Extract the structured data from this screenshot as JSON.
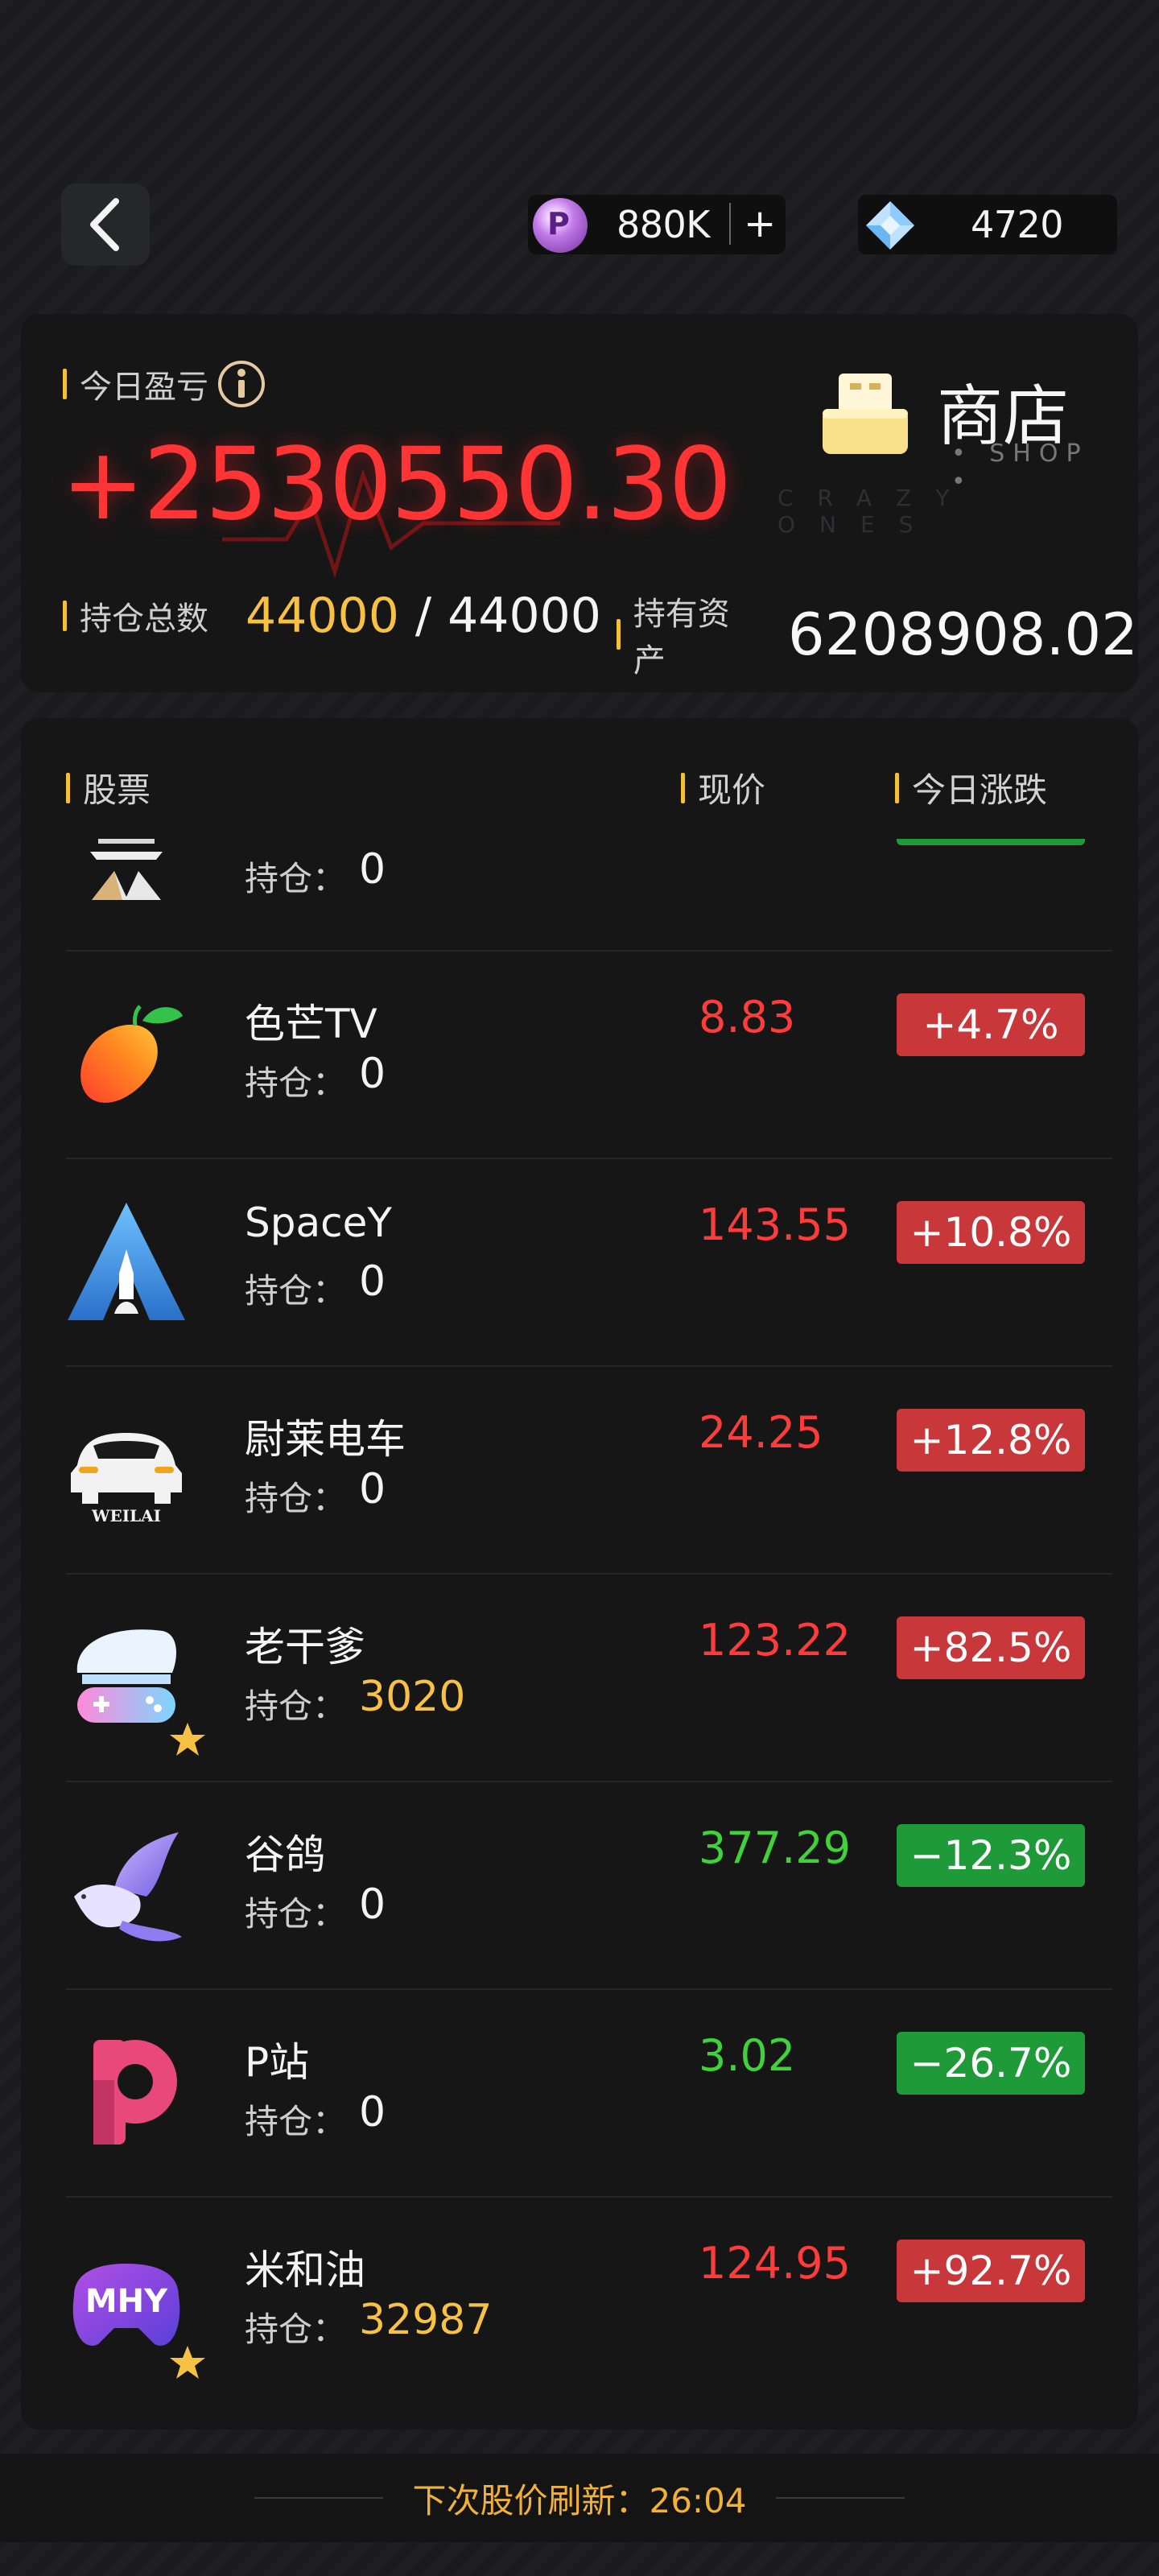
{
  "top_bar": {
    "coin_value": "880K",
    "coin_plus": "+",
    "gem_value": "4720"
  },
  "summary": {
    "today_pl_label": "今日盈亏",
    "today_pl_value": "+2530550.30",
    "holdings_label": "持仓总数",
    "holdings_used": "44000",
    "holdings_sep": "/",
    "holdings_total": "44000",
    "assets_label": "持有资产",
    "assets_value": "6208908.02",
    "shop_title": "商店",
    "shop_sub": "• SHOP •",
    "watermark": "CRAZY ONES"
  },
  "list": {
    "headers": {
      "stock": "股票",
      "price": "现价",
      "change": "今日涨跌"
    },
    "hold_label": "持仓：",
    "partial_row": {
      "hold": "0"
    },
    "rows": [
      {
        "name": "色芒TV",
        "hold": "0",
        "price": "8.83",
        "change": "+4.7%",
        "trend": "up",
        "icon": "mango-icon"
      },
      {
        "name": "SpaceY",
        "hold": "0",
        "price": "143.55",
        "change": "+10.8%",
        "trend": "up",
        "icon": "rocket-icon"
      },
      {
        "name": "尉莱电车",
        "hold": "0",
        "price": "24.25",
        "change": "+12.8%",
        "trend": "up",
        "icon": "car-icon",
        "icon_text": "WEILAI"
      },
      {
        "name": "老干爹",
        "hold": "3020",
        "price": "123.22",
        "change": "+82.5%",
        "trend": "up",
        "icon": "gamepad-hair-icon",
        "starred": true
      },
      {
        "name": "谷鸽",
        "hold": "0",
        "price": "377.29",
        "change": "−12.3%",
        "trend": "down",
        "icon": "dove-icon"
      },
      {
        "name": "P站",
        "hold": "0",
        "price": "3.02",
        "change": "−26.7%",
        "trend": "down",
        "icon": "p-logo-icon"
      },
      {
        "name": "米和油",
        "hold": "32987",
        "price": "124.95",
        "change": "+92.7%",
        "trend": "up",
        "icon": "mhy-gamepad-icon",
        "icon_text": "MHY",
        "starred": true
      }
    ]
  },
  "footer": {
    "refresh_text": "下次股价刷新：26:04"
  },
  "colors": {
    "up": "#ff3c3c",
    "down": "#3fd23a",
    "gold": "#f7c244",
    "accent_bar": "#f2c236"
  }
}
